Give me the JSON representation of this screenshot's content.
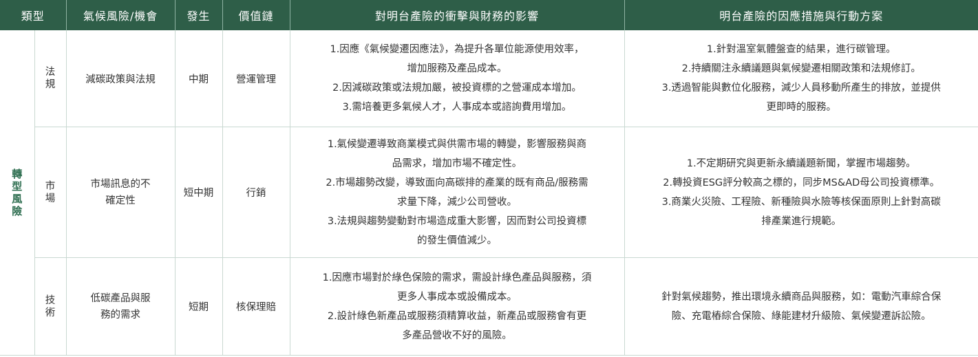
{
  "headers": [
    "類型",
    "氣候風險/機會",
    "發生",
    "價值鏈",
    "對明台產險的衝擊與財務的影響",
    "明台產險的因應措施與行動方案"
  ],
  "category": "轉型風險",
  "rows": [
    {
      "subtype": "法規",
      "risk": "減碳政策與法規",
      "timing": "中期",
      "value_chain": "營運管理",
      "impact": [
        "1.因應《氣候變遷因應法》，為提升各單位能源使用效率，",
        "增加服務及產品成本。",
        "2.因減碳政策或法規加嚴，被投資標的之營運成本增加。",
        "3.需培養更多氣候人才，人事成本或諮詢費用增加。"
      ],
      "actions": [
        "1.針對溫室氣體盤查的結果，進行碳管理。",
        "2.持續關注永續議題與氣候變遷相關政策和法規修訂。",
        "3.透過智能與數位化服務，減少人員移動所產生的排放，並提供",
        "更即時的服務。"
      ]
    },
    {
      "subtype": "市場",
      "risk": "市場訊息的不確定性",
      "timing": "短中期",
      "value_chain": "行銷",
      "impact": [
        "1.氣候變遷導致商業模式與供需市場的轉變，影響服務與商",
        "品需求，增加市場不確定性。",
        "2.市場趨勢改變，導致面向高碳排的產業的既有商品/服務需",
        "求量下降，減少公司營收。",
        "3.法規與趨勢變動對市場造成重大影響，因而對公司投資標",
        "的發生價值減少。"
      ],
      "actions": [
        "1.不定期研究與更新永續議題新聞，掌握市場趨勢。",
        "2.轉投資ESG評分較高之標的，同步MS&AD母公司投資標準。",
        "3.商業火災險、工程險、新種險與水險等核保面原則上針對高碳",
        "排產業進行規範。"
      ]
    },
    {
      "subtype": "技術",
      "risk": "低碳產品與服務的需求",
      "timing": "短期",
      "value_chain": "核保理賠",
      "impact": [
        "1.因應市場對於綠色保險的需求，需設計綠色產品與服務，須",
        "更多人事成本或設備成本。",
        "2.設計綠色新產品或服務須精算收益，新產品或服務會有更",
        "多產品營收不好的風險。"
      ],
      "actions": [
        "針對氣候趨勢，推出環境永續商品與服務，如：電動汽車綜合保",
        "險、充電樁綜合保險、綠能建材升級險、氣候變遷訴訟險。"
      ]
    }
  ]
}
